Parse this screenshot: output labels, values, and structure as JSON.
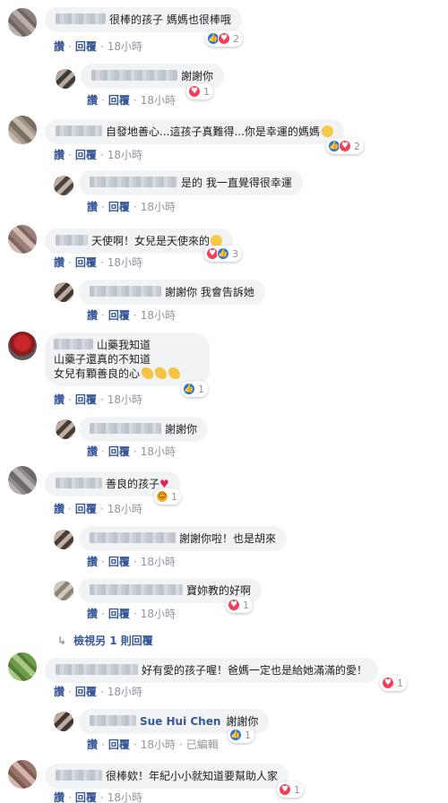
{
  "comments": [
    {
      "text": "很棒的孩子 媽媽也很棒哦",
      "time": "18小時",
      "react_count": "2"
    },
    {
      "text": "謝謝你",
      "time": "18小時",
      "react_count": "1"
    },
    {
      "text": "自發地善心...這孩子真難得...你是幸運的媽媽",
      "time": "18小時",
      "react_count": "2"
    },
    {
      "text": "是的 我一直覺得很幸運",
      "time": "18小時"
    },
    {
      "text": "天使啊！女兒是天使來的",
      "time": "18小時",
      "react_count": "3"
    },
    {
      "text": "謝謝你 我會告訴她",
      "time": "18小時"
    },
    {
      "text_lines": [
        "山藥我知道",
        "山藥子還真的不知道",
        "女兒有顆善良的心"
      ],
      "time": "18小時",
      "react_count": "1"
    },
    {
      "text": "謝謝你",
      "time": "18小時"
    },
    {
      "text": "善良的孩子",
      "time": "18小時",
      "react_count": "1"
    },
    {
      "text": "謝謝你啦！也是胡來",
      "time": "18小時"
    },
    {
      "text": "寶妳教的好啊",
      "time": "18小時",
      "react_count": "1"
    },
    {
      "text": "好有愛的孩子喔！爸媽一定也是給她滿滿的愛！",
      "time": "18小時",
      "react_count": "1"
    },
    {
      "name": "Sue Hui Chen",
      "text": "謝謝你",
      "time": "18小時",
      "edited": "已編輯",
      "react_count": "1"
    },
    {
      "text": "很棒欸！年紀小小就知道要幫助人家",
      "time": "18小時",
      "react_count": "1"
    }
  ],
  "actions": {
    "like": "讚",
    "reply": "回覆",
    "sep": "·"
  },
  "view_more_replies": "檢視另 1 則回覆",
  "colors": {
    "link": "#385898",
    "bubble": "#f2f3f5",
    "like": "#1877f2",
    "love": "#f33e58"
  }
}
